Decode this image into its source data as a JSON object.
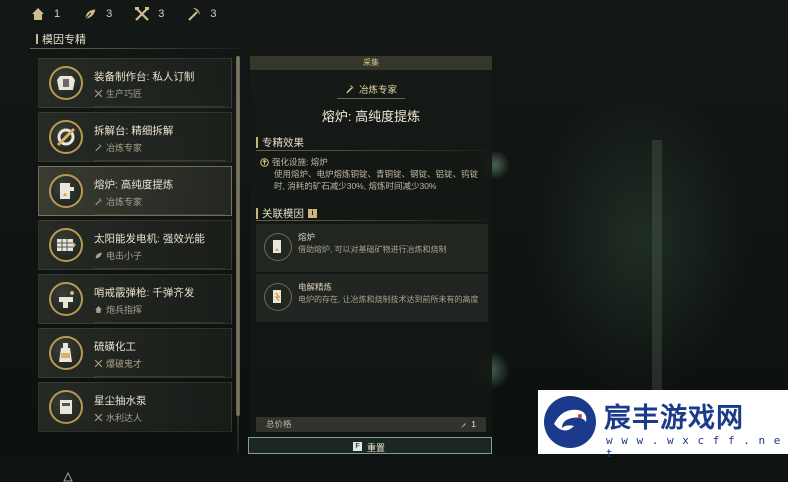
{
  "resources": [
    {
      "icon": "house-icon",
      "count": "1"
    },
    {
      "icon": "leaf-icon",
      "count": "3"
    },
    {
      "icon": "crossed-tools-icon",
      "count": "3"
    },
    {
      "icon": "pickaxe-icon",
      "count": "3"
    }
  ],
  "left_panel": {
    "title": "模因专精",
    "modules": [
      {
        "name": "装备制作台: 私人订制",
        "sub": "生产巧匠",
        "sub_icon": "crossed-tools-icon",
        "icon": "armor-icon",
        "active": false
      },
      {
        "name": "拆解台: 精细拆解",
        "sub": "冶炼专家",
        "sub_icon": "pickaxe-icon",
        "icon": "dismantle-icon",
        "active": false
      },
      {
        "name": "熔炉: 高纯度提炼",
        "sub": "冶炼专家",
        "sub_icon": "pickaxe-icon",
        "icon": "furnace-icon",
        "active": true
      },
      {
        "name": "太阳能发电机: 强效光能",
        "sub": "电击小子",
        "sub_icon": "leaf-icon",
        "icon": "solar-panel-icon",
        "active": false
      },
      {
        "name": "哨戒霰弹枪: 千弹齐发",
        "sub": "炮兵指挥",
        "sub_icon": "house-icon",
        "icon": "turret-icon",
        "active": false
      },
      {
        "name": "硫磺化工",
        "sub": "爆破鬼才",
        "sub_icon": "crossed-tools-icon",
        "icon": "bottle-icon",
        "active": false
      },
      {
        "name": "星尘抽水泵",
        "sub": "水利达人",
        "sub_icon": "crossed-tools-icon",
        "icon": "pump-icon",
        "active": false
      }
    ]
  },
  "detail": {
    "category": "采集",
    "spec_tag": "冶炼专家",
    "title": "熔炉: 高纯度提炼",
    "effect_header": "专精效果",
    "effect_facility": "强化设施: 熔炉",
    "effect_text": "使用熔炉、电炉熔炼铜锭、青铜锭、钢锭、铝锭、钨锭时, 消耗的矿石减少30%, 熔炼时间减少30%",
    "related_header": "关联模因",
    "info_glyph": "i",
    "genes": [
      {
        "name": "熔炉",
        "desc": "借助熔炉, 可以对基础矿物进行冶炼和烧制",
        "icon": "furnace-icon"
      },
      {
        "name": "电解精炼",
        "desc": "电炉的存在, 让冶炼和烧制技术达到前所未有的高度",
        "icon": "electric-furnace-icon"
      }
    ],
    "total_label": "总价格",
    "total_value": "1",
    "reset_key": "F",
    "reset_label": "重置"
  },
  "watermark": {
    "name": "宸丰游戏网",
    "url": "w w w . w x c f f . n e t"
  },
  "colors": {
    "accent": "#c9b37a",
    "text": "#e8e2cf",
    "muted": "#a9a28c",
    "watermark": "#1b3a8c"
  }
}
